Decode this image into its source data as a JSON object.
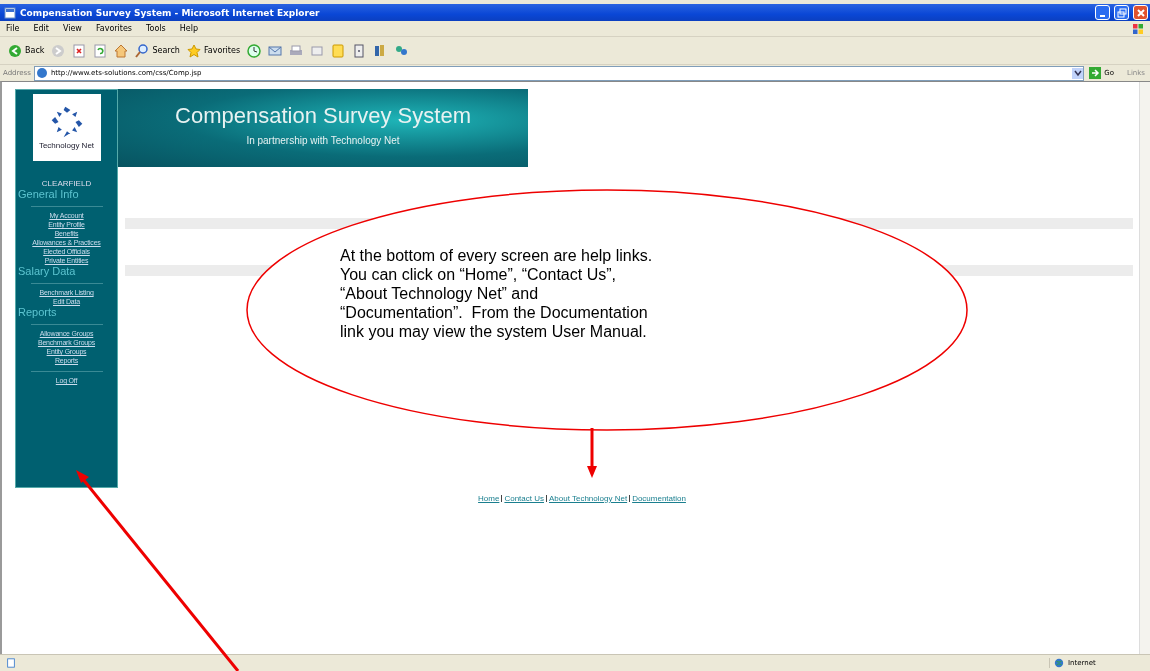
{
  "window": {
    "title": "Compensation Survey System - Microsoft Internet Explorer"
  },
  "menu": [
    "File",
    "Edit",
    "View",
    "Favorites",
    "Tools",
    "Help"
  ],
  "toolbar": [
    {
      "kind": "back",
      "label": "Back"
    },
    {
      "kind": "forward"
    },
    {
      "kind": "stop"
    },
    {
      "kind": "refresh"
    },
    {
      "kind": "home"
    },
    {
      "kind": "search",
      "label": "Search"
    },
    {
      "kind": "favorites",
      "label": "Favorites"
    },
    {
      "kind": "history"
    },
    {
      "kind": "mail"
    },
    {
      "kind": "print"
    },
    {
      "kind": "edit"
    },
    {
      "kind": "note"
    },
    {
      "kind": "device"
    },
    {
      "kind": "books"
    },
    {
      "kind": "people"
    }
  ],
  "address": {
    "label": "Address",
    "value": "http://www.ets-solutions.com/css/Comp.jsp",
    "go": "Go",
    "links": "Links"
  },
  "logo": {
    "caption": "Technology Net"
  },
  "banner": {
    "title": "Compensation Survey System",
    "subtitle": "In partnership with Technology Net"
  },
  "sidebar": {
    "entity": "CLEARFIELD",
    "sections": [
      {
        "heading": "General Info",
        "links": [
          "My Account",
          "Entity Profile",
          "Benefits",
          "Allowances & Practices",
          "Elected Officials",
          "Private Entities"
        ]
      },
      {
        "heading": "Salary Data",
        "links": [
          "Benchmark Listing",
          "Edit Data"
        ]
      },
      {
        "heading": "Reports",
        "links": [
          "Allowance Groups",
          "Benchmark Groups",
          "Entity Groups",
          "Reports"
        ]
      },
      {
        "links": [
          "Log Off"
        ]
      }
    ]
  },
  "footer_links": [
    "Home",
    "Contact Us",
    "About Technology Net",
    "Documentation"
  ],
  "callout": {
    "text": "At the bottom of every screen are help links.\nYou can click on “Home”, “Contact Us”,\n“About Technology Net” and\n“Documentation”.  From the Documentation\nlink you may view the system User Manual."
  },
  "status_bar": {
    "zone": "Internet"
  }
}
